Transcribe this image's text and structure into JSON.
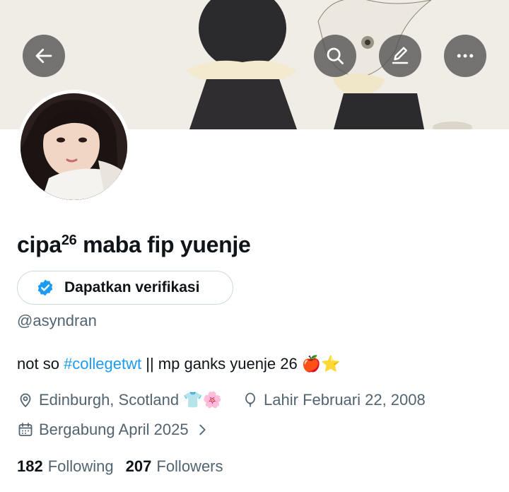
{
  "header": {
    "back_icon": "arrow-left-icon",
    "search_icon": "search-icon",
    "edit_icon": "edit-pencil-icon",
    "more_icon": "more-horizontal-icon"
  },
  "profile": {
    "name_main": "cipa",
    "name_sup": "26",
    "name_rest": " maba fip yuenje",
    "verify_label": "Dapatkan verifikasi",
    "handle": "@asyndran",
    "bio": {
      "prefix": "not so ",
      "hashtag": "#collegetwt",
      "suffix": " || mp ganks yuenje 26 🍎⭐"
    },
    "location": "Edinburgh, Scotland 👕🌸",
    "birthday": "Lahir Februari 22, 2008",
    "joined": "Bergabung April 2025"
  },
  "stats": {
    "following_count": "182",
    "following_label": "Following",
    "followers_count": "207",
    "followers_label": "Followers"
  },
  "colors": {
    "accent": "#1d9bf0",
    "secondary_text": "#536471",
    "primary_text": "#0f1419"
  }
}
